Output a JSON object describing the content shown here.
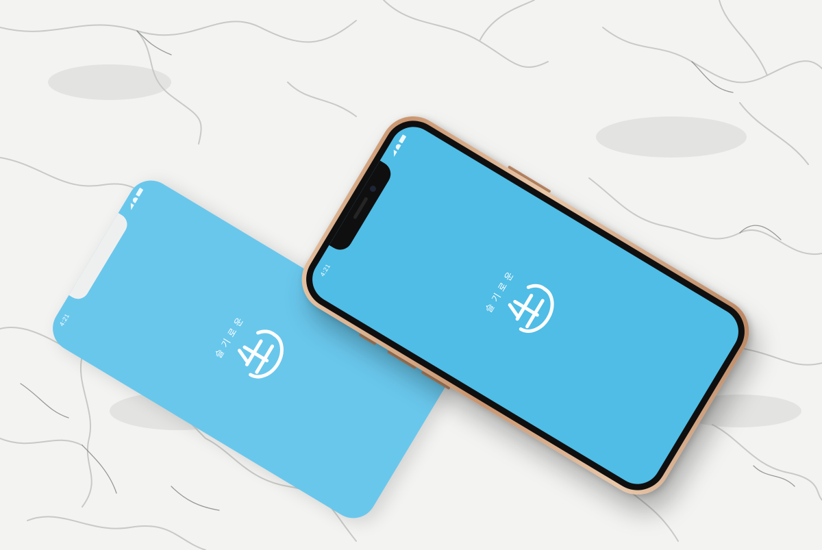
{
  "scene": {
    "background": "marble",
    "accent_color": "#4fbde6",
    "sheet_color": "#69c7ec",
    "phone_frame_color": "#d4a17c"
  },
  "sheet": {
    "status_time": "4:21",
    "brand_text": "슬기로운"
  },
  "phone": {
    "status_time": "4:21",
    "brand_text": "슬기로운"
  }
}
